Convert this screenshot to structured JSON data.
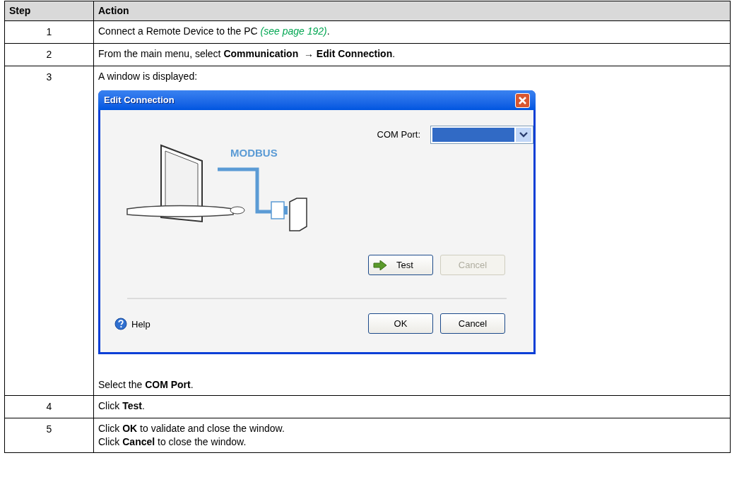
{
  "table": {
    "columns": [
      "Step",
      "Action"
    ],
    "rows": [
      {
        "step": "1",
        "blocks": [
          {
            "kind": "paragraph",
            "parts": [
              {
                "kind": "text",
                "text": "Connect a Remote Device to the PC "
              },
              {
                "kind": "link",
                "text": "(see page 192)"
              },
              {
                "kind": "text",
                "text": "."
              }
            ]
          }
        ]
      },
      {
        "step": "2",
        "blocks": [
          {
            "kind": "paragraph",
            "parts": [
              {
                "kind": "text",
                "text": "From the main menu, select **Communication  → Edit Connection**."
              }
            ]
          }
        ]
      },
      {
        "step": "3",
        "blocks": [
          {
            "kind": "paragraph",
            "parts": [
              {
                "kind": "text",
                "text": "A window is displayed:"
              }
            ]
          },
          {
            "kind": "dialog",
            "title": "Edit Connection",
            "diagram_label": "MODBUS",
            "com_port_label": "COM Port:",
            "action_buttons": [
              {
                "label": "Test",
                "disabled": false
              },
              {
                "label": "Cancel",
                "disabled": true
              }
            ],
            "footer_buttons": [
              {
                "label": "OK"
              },
              {
                "label": "Cancel"
              }
            ],
            "help": "Help"
          },
          {
            "kind": "paragraph",
            "parts": [
              {
                "kind": "text",
                "text": "Select the **COM Port**."
              }
            ]
          }
        ]
      },
      {
        "step": "4",
        "blocks": [
          {
            "kind": "paragraph",
            "parts": [
              {
                "kind": "text",
                "text": "Click **Test**."
              }
            ]
          }
        ]
      },
      {
        "step": "5",
        "blocks": [
          {
            "kind": "paragraph",
            "parts": [
              {
                "kind": "text",
                "text": "Click **OK** to validate and close the window."
              }
            ]
          },
          {
            "kind": "paragraph",
            "parts": [
              {
                "kind": "text",
                "text": "Click **Cancel** to close the window."
              }
            ]
          }
        ]
      }
    ]
  }
}
